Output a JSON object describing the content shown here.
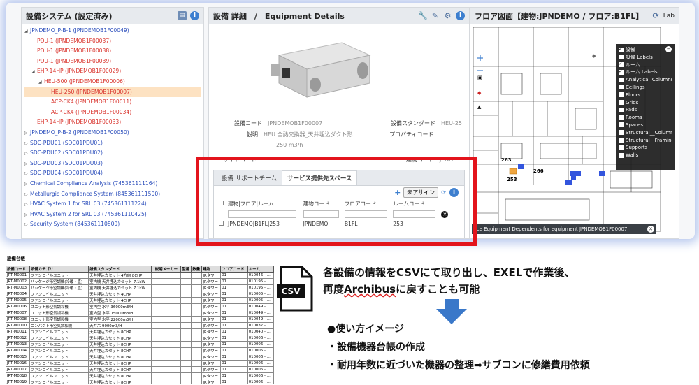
{
  "tree_panel": {
    "title": "設備システム (設定済み)",
    "items": [
      {
        "label": "JPNDEMO_P-B-1 (JPNDEMOB1F00049)",
        "level": 0,
        "color": "root",
        "expanded": true
      },
      {
        "label": "PDU-1 (JPNDEMOB1F00037)",
        "level": 1,
        "color": "red",
        "expanded": null
      },
      {
        "label": "PDU-1 (JPNDEMOB1F00038)",
        "level": 1,
        "color": "red",
        "expanded": null
      },
      {
        "label": "PDU-1 (JPNDEMOB1F00039)",
        "level": 1,
        "color": "red",
        "expanded": null
      },
      {
        "label": "EHP-14HP (JPNDEMOB1F00029)",
        "level": 1,
        "color": "red",
        "expanded": true
      },
      {
        "label": "HEU-500 (JPNDEMOB1F00006)",
        "level": 2,
        "color": "red",
        "expanded": true
      },
      {
        "label": "HEU-250 (JPNDEMOB1F00007)",
        "level": 3,
        "color": "red",
        "expanded": null,
        "selected": true
      },
      {
        "label": "ACP-CK4 (JPNDEMOB1F00011)",
        "level": 3,
        "color": "red",
        "expanded": null
      },
      {
        "label": "ACP-CK4 (JPNDEMOB1F00034)",
        "level": 3,
        "color": "red",
        "expanded": null
      },
      {
        "label": "EHP-14HP (JPNDEMOB1F00033)",
        "level": 1,
        "color": "red",
        "expanded": null
      },
      {
        "label": "JPNDEMO_P-B-2 (JPNDEMOB1F00050)",
        "level": 0,
        "color": "root",
        "expanded": false
      },
      {
        "label": "SDC-PDU01 (SDC01PDU01)",
        "level": 0,
        "color": "root",
        "expanded": false
      },
      {
        "label": "SDC-PDU02 (SDC01PDU02)",
        "level": 0,
        "color": "root",
        "expanded": false
      },
      {
        "label": "SDC-PDU03 (SDC01PDU03)",
        "level": 0,
        "color": "root",
        "expanded": false
      },
      {
        "label": "SDC-PDU04 (SDC01PDU04)",
        "level": 0,
        "color": "root",
        "expanded": false
      },
      {
        "label": "Chemical Compliance Analysis (745361111164)",
        "level": 0,
        "color": "root",
        "expanded": false
      },
      {
        "label": "Metallurgic Compliance System (845361111500)",
        "level": 0,
        "color": "root",
        "expanded": false
      },
      {
        "label": "HVAC System 1 for SRL 03 (745361111224)",
        "level": 0,
        "color": "root",
        "expanded": false
      },
      {
        "label": "HVAC System 2 for SRL 03 (745361110425)",
        "level": 0,
        "color": "root",
        "expanded": false
      },
      {
        "label": "Security System (845361110800)",
        "level": 0,
        "color": "root",
        "expanded": false
      }
    ]
  },
  "detail_panel": {
    "title": "設備 詳細　/　Equipment Details",
    "fields": [
      {
        "label": "設備コード",
        "value": "JPNDEMOB1F00007"
      },
      {
        "label": "説明",
        "value": "HEU 全熱交換器_天井埋込ダクト形"
      },
      {
        "label": "",
        "value": "250 m3/h"
      },
      {
        "label": "サイトコード",
        "value": ""
      }
    ],
    "fields_right": [
      {
        "label": "設備スタンダード",
        "value": "HEU-25"
      },
      {
        "label": "プロパティコード",
        "value": ""
      },
      {
        "label": "建物コード",
        "value": "JPNDE"
      }
    ],
    "tabs": [
      "設備 サポートチーム",
      "サービス提供先スペース"
    ],
    "unassign_label": "未アサイン",
    "grid_headers": [
      "建物|フロア|ルーム",
      "建物コード",
      "フロアコード",
      "ルームコード"
    ],
    "grid_rows": [
      [
        "JPNDEMO|B1FL|253",
        "JPNDEMO",
        "B1FL",
        "253"
      ]
    ]
  },
  "floor_panel": {
    "title": "フロア図面【建物:JPNDEMO / フロア:B1FL】",
    "labels_btn": "Lab",
    "layers": [
      {
        "label": "設備",
        "checked": true
      },
      {
        "label": "設備 Labels",
        "checked": false
      },
      {
        "label": "ルーム",
        "checked": true
      },
      {
        "label": "ルーム Labels",
        "checked": true
      },
      {
        "label": "Analytical_Columns",
        "checked": false
      },
      {
        "label": "Ceilings",
        "checked": false
      },
      {
        "label": "Floors",
        "checked": false
      },
      {
        "label": "Grids",
        "checked": false
      },
      {
        "label": "Pads",
        "checked": false
      },
      {
        "label": "Rooms",
        "checked": false
      },
      {
        "label": "Spaces",
        "checked": false
      },
      {
        "label": "Structural__Columns",
        "checked": false
      },
      {
        "label": "Structural__Framing",
        "checked": false
      },
      {
        "label": "Supports",
        "checked": false
      },
      {
        "label": "Walls",
        "checked": false
      }
    ],
    "room_labels": [
      "263",
      "266",
      "253"
    ],
    "tooltip": "rce Equipment Dependents for equipment JPNDEMOB1F00007"
  },
  "sheet": {
    "title": "設備台帳",
    "headers": [
      "設備コード",
      "設備カテゴリ",
      "設備スタンダード",
      "",
      "説明メーカー",
      "型番",
      "数量",
      "建物",
      "フロアコード",
      "ルーム"
    ],
    "rows": [
      [
        "JRT-M0001",
        "ファンコイルユニット",
        "天井埋込カセット 4方向 8CHP",
        "",
        "",
        "",
        "",
        "JRタワー",
        "01",
        "010046 - ..."
      ],
      [
        "JRT-M0002",
        "パッケージ形空調機(冷暖・直)",
        "室内機 天井埋込カセット 7.1kW",
        "",
        "",
        "",
        "",
        "JRタワー",
        "01",
        "010195 - ..."
      ],
      [
        "JRT-M0003",
        "パッケージ形空調機(冷暖・直)",
        "室内機 天井埋込カセット 7.1kW",
        "",
        "",
        "",
        "",
        "JRタワー",
        "01",
        "010195 - ..."
      ],
      [
        "JRT-M0004",
        "ファンコイルユニット",
        "天井埋込カセット 4CHP",
        "",
        "",
        "",
        "",
        "JRタワー",
        "01",
        "010005 - ..."
      ],
      [
        "JRT-M0005",
        "ファンコイルユニット",
        "天井埋込カセット 4CHP",
        "",
        "",
        "",
        "",
        "JRタワー",
        "01",
        "010005 - ..."
      ],
      [
        "JRT-M0006",
        "ユニット形空気調和機",
        "室内型 水平 36000m3/H",
        "",
        "",
        "",
        "",
        "JRタワー",
        "01",
        "010049 - ..."
      ],
      [
        "JRT-M0007",
        "ユニット形空気調和機",
        "室内型 水平 15000m3/H",
        "",
        "",
        "",
        "",
        "JRタワー",
        "01",
        "010049 - ..."
      ],
      [
        "JRT-M0008",
        "ユニット形空気調和機",
        "室内型 水平 22000m3/H",
        "",
        "",
        "",
        "",
        "JRタワー",
        "01",
        "010049 - ..."
      ],
      [
        "JRT-M0010",
        "コンパクト形空気調和機",
        "天井吊 9000m3/H",
        "",
        "",
        "",
        "",
        "JRタワー",
        "01",
        "010037 - ..."
      ],
      [
        "JRT-M0011",
        "ファンコイルユニット",
        "天井埋込カセット 8CHP",
        "",
        "",
        "",
        "",
        "JRタワー",
        "01",
        "010040 - ..."
      ],
      [
        "JRT-M0012",
        "ファンコイルユニット",
        "天井埋込カセット 8CHP",
        "",
        "",
        "",
        "",
        "JRタワー",
        "01",
        "010006 - ..."
      ],
      [
        "JRT-M0013",
        "ファンコイルユニット",
        "天井埋込カセット 8CHP",
        "",
        "",
        "",
        "",
        "JRタワー",
        "01",
        "010006 - ..."
      ],
      [
        "JRT-M0014",
        "ファンコイルユニット",
        "天井埋込カセット 8CHP",
        "",
        "",
        "",
        "",
        "JRタワー",
        "01",
        "010005 - ..."
      ],
      [
        "JRT-M0015",
        "ファンコイルユニット",
        "天井埋込カセット 8CHP",
        "",
        "",
        "",
        "",
        "JRタワー",
        "01",
        "010006 - ..."
      ],
      [
        "JRT-M0016",
        "ファンコイルユニット",
        "天井埋込カセット 8CHP",
        "",
        "",
        "",
        "",
        "JRタワー",
        "01",
        "010006 - ..."
      ],
      [
        "JRT-M0017",
        "ファンコイルユニット",
        "天井埋込カセット 8CHP",
        "",
        "",
        "",
        "",
        "JRタワー",
        "01",
        "010006 - ..."
      ],
      [
        "JRT-M0018",
        "ファンコイルユニット",
        "天井埋込カセット 8CHP",
        "",
        "",
        "",
        "",
        "JRタワー",
        "01",
        "010006 - ..."
      ],
      [
        "JRT-M0019",
        "ファンコイルユニット",
        "天井埋込カセット 8CHP",
        "",
        "",
        "",
        "",
        "JRタワー",
        "01",
        "010006 - ..."
      ],
      [
        "JRT-M0020",
        "ファンコイルユニット",
        "天井埋込カセット 8CHP",
        "",
        "",
        "",
        "",
        "JRタワー",
        "01",
        "010006 - ..."
      ],
      [
        "JRT-M0021",
        "ファンコイルユニット",
        "天井埋込カセット 8CHP",
        "",
        "",
        "",
        "",
        "JRタワー",
        "01",
        "010006 - ..."
      ]
    ]
  },
  "csv_icon_label": "CSV",
  "message": {
    "line1": "各設備の情報をCSVにて取り出し、EXELで作業後、",
    "line2_pre": "再度",
    "line2_word": "Archibus",
    "line2_post": "に戻すことも可能"
  },
  "bullets": {
    "heading": "●使い方イメージ",
    "items": [
      "・設備機器台帳の作成",
      "・耐用年数に近づいた機器の整理⇒サブコンに修繕費用依頼"
    ]
  },
  "colors": {
    "frame_red": "#e3141c",
    "arrow_blue": "#3a78c9",
    "link_blue": "#2a4dbb",
    "tree_red": "#d9322b"
  }
}
